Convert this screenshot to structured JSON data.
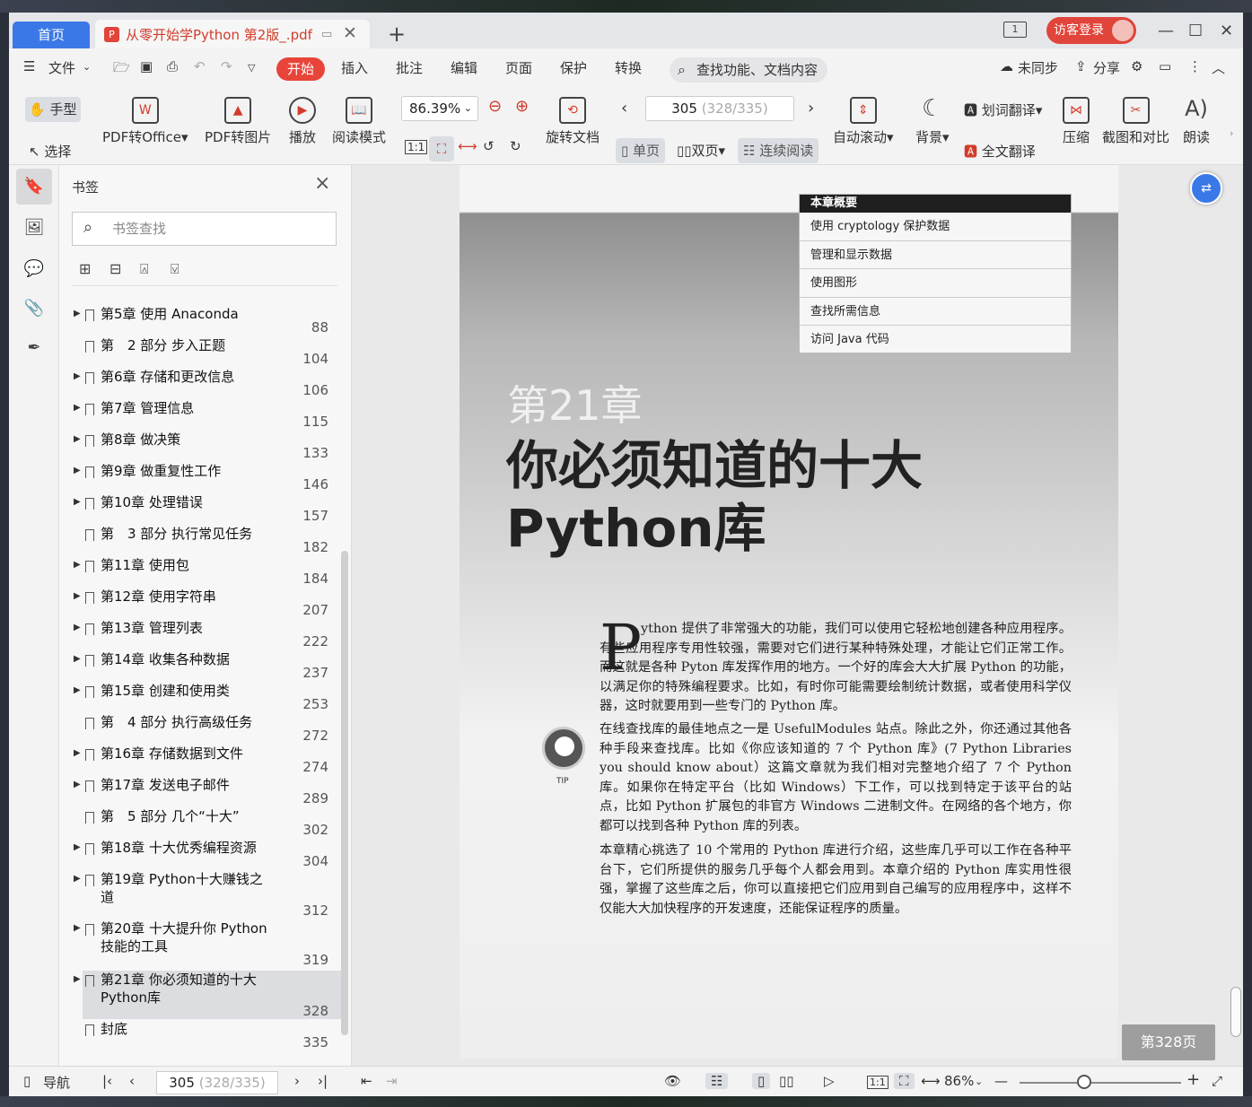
{
  "tabs": {
    "home": "首页",
    "document": "从零开始学Python 第2版_.pdf"
  },
  "titlebar": {
    "page_indicator": "1",
    "login": "访客登录"
  },
  "menu": {
    "file": "文件",
    "items": [
      "开始",
      "插入",
      "批注",
      "编辑",
      "页面",
      "保护",
      "转换"
    ],
    "search": "查找功能、文档内容",
    "sync": "未同步",
    "share": "分享"
  },
  "toolbar": {
    "hand": "手型",
    "select": "选择",
    "pdf_to_office": "PDF转Office",
    "pdf_to_image": "PDF转图片",
    "play": "播放",
    "read_mode": "阅读模式",
    "zoom": "86.39%",
    "rotate": "旋转文档",
    "page_current": "305",
    "page_total": "(328/335)",
    "single": "单页",
    "double": "双页",
    "continuous": "连续阅读",
    "auto_scroll": "自动滚动",
    "background": "背景",
    "word_translate": "划词翻译",
    "full_translate": "全文翻译",
    "compress": "压缩",
    "screenshot": "截图和对比",
    "read_aloud": "朗读"
  },
  "bookmarks": {
    "title": "书签",
    "search_placeholder": "书签查找",
    "items": [
      {
        "label": "第5章 使用 Anaconda",
        "page": "88",
        "expandable": true
      },
      {
        "label": "第　2 部分 步入正题",
        "page": "104",
        "expandable": false
      },
      {
        "label": "第6章 存储和更改信息",
        "page": "106",
        "expandable": true
      },
      {
        "label": "第7章 管理信息",
        "page": "115",
        "expandable": true
      },
      {
        "label": "第8章 做决策",
        "page": "133",
        "expandable": true
      },
      {
        "label": "第9章 做重复性工作",
        "page": "146",
        "expandable": true
      },
      {
        "label": "第10章 处理错误",
        "page": "157",
        "expandable": true
      },
      {
        "label": "第　3 部分 执行常见任务",
        "page": "182",
        "expandable": false
      },
      {
        "label": "第11章 使用包",
        "page": "184",
        "expandable": true
      },
      {
        "label": "第12章 使用字符串",
        "page": "207",
        "expandable": true
      },
      {
        "label": "第13章 管理列表",
        "page": "222",
        "expandable": true
      },
      {
        "label": "第14章 收集各种数据",
        "page": "237",
        "expandable": true
      },
      {
        "label": "第15章 创建和使用类",
        "page": "253",
        "expandable": true
      },
      {
        "label": "第　4 部分 执行高级任务",
        "page": "272",
        "expandable": false
      },
      {
        "label": "第16章 存储数据到文件",
        "page": "274",
        "expandable": true
      },
      {
        "label": "第17章 发送电子邮件",
        "page": "289",
        "expandable": true
      },
      {
        "label": "第　5 部分 几个“十大”",
        "page": "302",
        "expandable": false
      },
      {
        "label": "第18章 十大优秀编程资源",
        "page": "304",
        "expandable": true
      },
      {
        "label": "第19章 Python十大赚钱之道",
        "page": "312",
        "expandable": true
      },
      {
        "label": "第20章 十大提升你 Python 技能的工具",
        "page": "319",
        "expandable": true
      },
      {
        "label": "第21章 你必须知道的十大 Python库",
        "page": "328",
        "expandable": true,
        "selected": true
      },
      {
        "label": "封底",
        "page": "335",
        "expandable": false
      }
    ]
  },
  "document_page": {
    "summary_title": "本章概要",
    "summary_items": [
      "使用 cryptology 保护数据",
      "管理和显示数据",
      "使用图形",
      "查找所需信息",
      "访问 Java 代码"
    ],
    "chapter_number": "第21章",
    "chapter_title_line1": "你必须知道的十大",
    "chapter_title_line2": "Python库",
    "drop_cap": "P",
    "paragraph1": "ython 提供了非常强大的功能，我们可以使用它轻松地创建各种应用程序。有些应用程序专用性较强，需要对它们进行某种特殊处理，才能让它们正常工作。而这就是各种 Pyton 库发挥作用的地方。一个好的库会大大扩展 Python 的功能，以满足你的特殊编程要求。比如，有时你可能需要绘制统计数据，或者使用科学仪器，这时就要用到一些专门的 Python 库。",
    "tip_label": "TIP",
    "paragraph2": "在线查找库的最佳地点之一是 UsefulModules 站点。除此之外，你还通过其他各种手段来查找库。比如《你应该知道的 7 个 Python 库》(7 Python Libraries you should know about）这篇文章就为我们相对完整地介绍了 7 个 Python 库。如果你在特定平台（比如 Windows）下工作，可以找到特定于该平台的站点，比如 Python 扩展包的非官方 Windows 二进制文件。在网络的各个地方，你都可以找到各种 Python 库的列表。",
    "paragraph3": "本章精心挑选了 10 个常用的 Python 库进行介绍，这些库几乎可以工作在各种平台下，它们所提供的服务几乎每个人都会用到。本章介绍的 Python 库实用性很强，掌握了这些库之后，你可以直接把它们应用到自己编写的应用程序中，这样不仅能大大加快程序的开发速度，还能保证程序的质量。",
    "page_badge": "第328页"
  },
  "statusbar": {
    "nav": "导航",
    "page_current": "305",
    "page_total": "(328/335)",
    "zoom": "86%",
    "zoom_level": 0.4
  }
}
